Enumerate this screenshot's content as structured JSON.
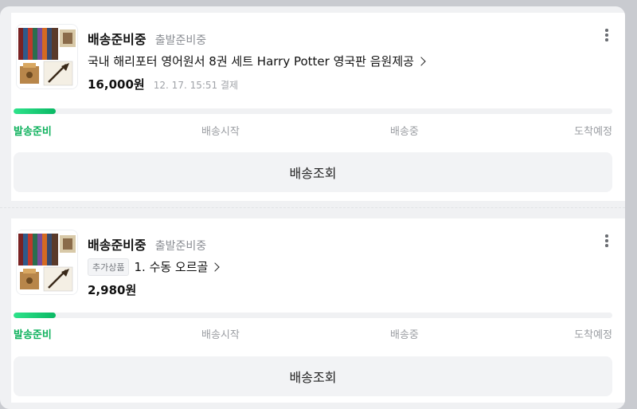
{
  "orders": [
    {
      "status": "배송준비중",
      "status_detail": "출발준비중",
      "tag": "",
      "product_name": "국내 해리포터 영어원서 8권 세트 Harry Potter 영국판 음원제공",
      "price": "16,000원",
      "payment_info": "12. 17. 15:51 결제",
      "progress": 0.07,
      "steps": [
        "발송준비",
        "배송시작",
        "배송중",
        "도착예정"
      ],
      "active_step": "발송준비",
      "button_label": "배송조회"
    },
    {
      "status": "배송준비중",
      "status_detail": "출발준비중",
      "tag": "추가상품",
      "product_name": "1. 수동 오르골",
      "price": "2,980원",
      "payment_info": "",
      "progress": 0.07,
      "steps": [
        "발송준비",
        "배송시작",
        "배송중",
        "도착예정"
      ],
      "active_step": "발송준비",
      "button_label": "배송조회"
    }
  ],
  "icons": {
    "more": "more-vertical-icon",
    "chevron": "chevron-right-icon"
  },
  "colors": {
    "accent_green": "#10b25e",
    "progress_fill": "#0ab864",
    "button_bg": "#f2f3f5"
  }
}
